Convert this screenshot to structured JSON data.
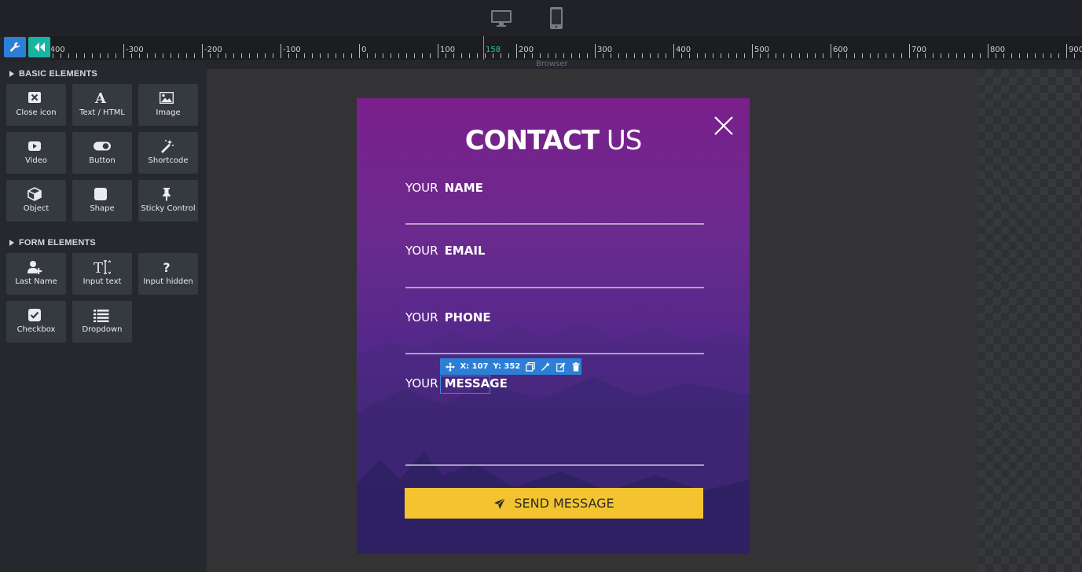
{
  "devices": {
    "desktop_icon": "desktop-monitor-icon",
    "mobile_icon": "mobile-phone-icon"
  },
  "toolbar": {
    "settings_icon": "wrench-icon",
    "collapse_icon": "double-chevron-left-icon",
    "accent_blue": "#2d7fd6",
    "accent_teal": "#17b3a3"
  },
  "ruler": {
    "labels": [
      {
        "text": "-400"
      },
      {
        "text": "-300"
      },
      {
        "text": "-200"
      },
      {
        "text": "-100"
      },
      {
        "text": "0"
      },
      {
        "text": "100"
      },
      {
        "text": "158"
      },
      {
        "text": "200"
      },
      {
        "text": "300"
      },
      {
        "text": "400"
      },
      {
        "text": "500"
      },
      {
        "text": "600"
      },
      {
        "text": "700"
      },
      {
        "text": "800"
      },
      {
        "text": "900"
      }
    ],
    "marker": "158",
    "marker_color": "#26c6a4",
    "caption": "Browser"
  },
  "sidebar": {
    "basic_title": "BASIC ELEMENTS",
    "basic": [
      {
        "label": "Close icon",
        "icon": "close-box-icon"
      },
      {
        "label": "Text / HTML",
        "icon": "text-a-icon"
      },
      {
        "label": "Image",
        "icon": "image-icon"
      },
      {
        "label": "Video",
        "icon": "video-play-icon"
      },
      {
        "label": "Button",
        "icon": "toggle-icon"
      },
      {
        "label": "Shortcode",
        "icon": "magic-wand-icon"
      },
      {
        "label": "Object",
        "icon": "cube-icon"
      },
      {
        "label": "Shape",
        "icon": "square-shape-icon"
      },
      {
        "label": "Sticky Control",
        "icon": "pin-icon"
      }
    ],
    "form_title": "FORM ELEMENTS",
    "form": [
      {
        "label": "Last Name",
        "icon": "user-plus-icon"
      },
      {
        "label": "Input text",
        "icon": "text-input-icon"
      },
      {
        "label": "Input hidden",
        "icon": "question-mark-icon"
      },
      {
        "label": "Checkbox",
        "icon": "checkbox-icon"
      },
      {
        "label": "Dropdown",
        "icon": "list-icon"
      }
    ]
  },
  "popup": {
    "title_bold": "CONTACT",
    "title_thin": "US",
    "close_icon": "close-x-icon",
    "fields": [
      {
        "prefix": "YOUR",
        "name": "NAME"
      },
      {
        "prefix": "YOUR",
        "name": "EMAIL"
      },
      {
        "prefix": "YOUR",
        "name": "PHONE"
      },
      {
        "prefix": "YOUR",
        "name": "MESSAGE"
      }
    ],
    "button_label": "SEND MESSAGE",
    "button_icon": "paper-plane-icon",
    "button_color": "#f4c430"
  },
  "selection": {
    "x_label": "X: 107",
    "y_label": "Y: 352",
    "icons": [
      "move-icon",
      "duplicate-icon",
      "eyedropper-icon",
      "edit-icon",
      "trash-icon"
    ]
  }
}
